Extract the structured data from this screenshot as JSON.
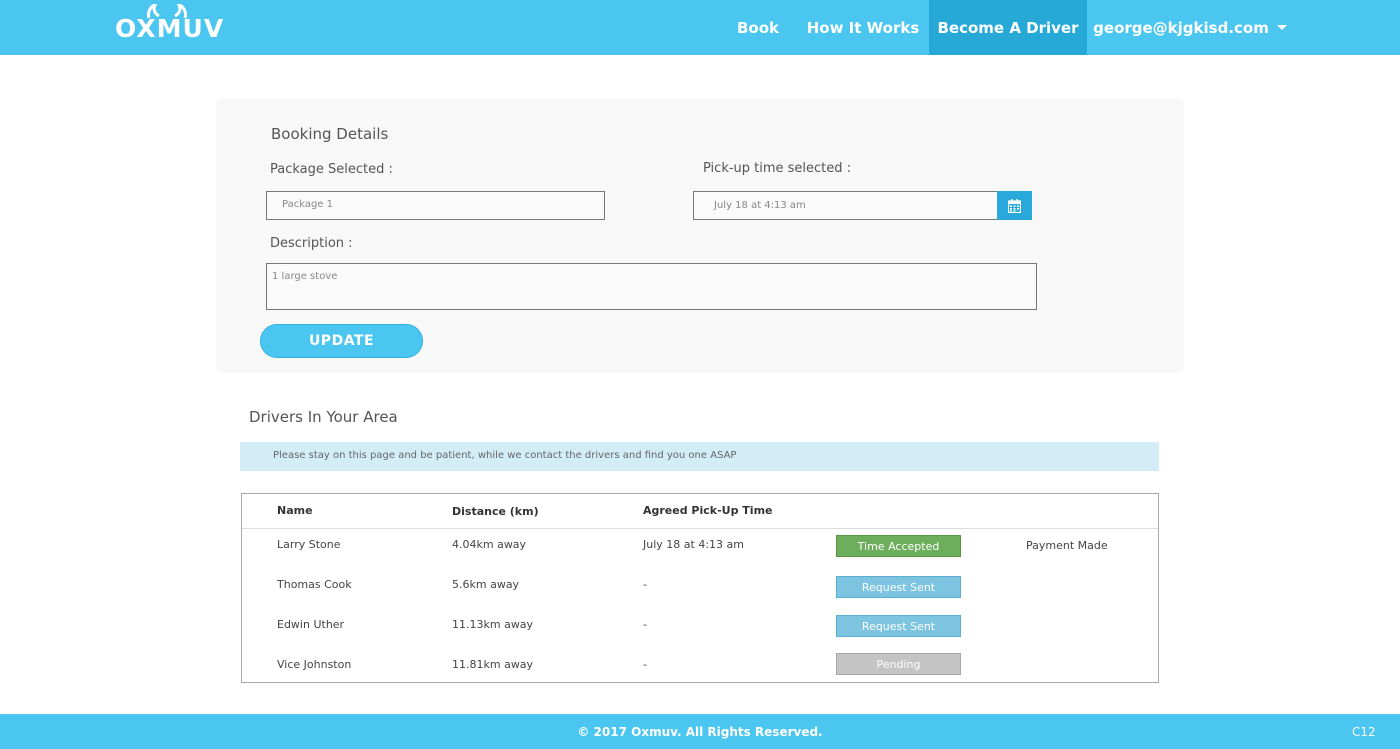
{
  "header": {
    "logo_text": "OXMUV",
    "nav": {
      "book": "Book",
      "how_it_works": "How It Works",
      "become_driver": "Become A Driver",
      "user_email": "george@kjgkisd.com"
    }
  },
  "booking": {
    "title": "Booking Details",
    "package_label": "Package Selected :",
    "package_value": "Package 1",
    "pickup_label": "Pick-up time selected :",
    "pickup_value": "July 18 at 4:13 am",
    "description_label": "Description :",
    "description_value": "1 large stove",
    "update_label": "UPDATE"
  },
  "drivers": {
    "title": "Drivers In Your Area",
    "notice": "Please stay on this page and be patient, while we contact the drivers and find you one ASAP",
    "headers": {
      "name": "Name",
      "distance": "Distance (km)",
      "pickup_time": "Agreed Pick-Up Time"
    },
    "rows": [
      {
        "name": "Larry Stone",
        "distance": "4.04km away",
        "time": "July 18 at 4:13 am",
        "status": "Time Accepted",
        "extra": "Payment Made"
      },
      {
        "name": "Thomas Cook",
        "distance": "5.6km away",
        "time": "-",
        "status": "Request Sent",
        "extra": ""
      },
      {
        "name": "Edwin Uther",
        "distance": "11.13km away",
        "time": "-",
        "status": "Request Sent",
        "extra": ""
      },
      {
        "name": "Vice Johnston",
        "distance": "11.81km away",
        "time": "-",
        "status": "Pending",
        "extra": ""
      }
    ]
  },
  "footer": {
    "copyright": "© 2017 Oxmuv. All Rights Reserved.",
    "code": "C12"
  },
  "colors": {
    "brand": "#4ac6f1",
    "nav_active": "#27a9d8",
    "accepted": "#6cae5c",
    "sent": "#7cc4e0",
    "pending": "#c4c4c4"
  },
  "icons": {
    "calendar": "calendar-icon",
    "caret": "caret-down-icon"
  }
}
